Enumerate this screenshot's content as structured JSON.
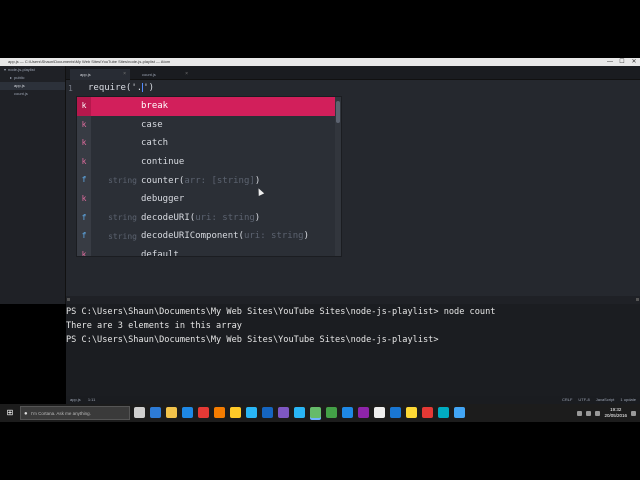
{
  "window": {
    "title": "app.js — C:\\Users\\Shaun\\Documents\\My Web Sites\\YouTube Sites\\node-js-playlist — Atom",
    "controls": {
      "minimize": "—",
      "maximize": "☐",
      "close": "✕"
    }
  },
  "tree_view": {
    "project": "node-js-playlist",
    "items": [
      {
        "label": "public",
        "icon": "folder-icon"
      },
      {
        "label": "app.js",
        "icon": "file-icon",
        "selected": true
      },
      {
        "label": "count.js",
        "icon": "file-icon"
      }
    ]
  },
  "tabs": [
    {
      "label": "app.js",
      "active": true
    },
    {
      "label": "count.js",
      "active": false
    }
  ],
  "editor": {
    "line_number": "1",
    "code_before_cursor": "require('.",
    "code_after_cursor": "')"
  },
  "autocomplete": {
    "items": [
      {
        "kind": "k",
        "type": "keyword",
        "left": "",
        "text": "break",
        "params": "",
        "tail": "",
        "selected": true
      },
      {
        "kind": "k",
        "type": "keyword",
        "left": "",
        "text": "case",
        "params": "",
        "tail": ""
      },
      {
        "kind": "k",
        "type": "keyword",
        "left": "",
        "text": "catch",
        "params": "",
        "tail": ""
      },
      {
        "kind": "k",
        "type": "keyword",
        "left": "",
        "text": "continue",
        "params": "",
        "tail": ""
      },
      {
        "kind": "f",
        "type": "function",
        "left": "string",
        "text": "counter(",
        "params": "arr: [string]",
        "tail": ")"
      },
      {
        "kind": "k",
        "type": "keyword",
        "left": "",
        "text": "debugger",
        "params": "",
        "tail": ""
      },
      {
        "kind": "f",
        "type": "function",
        "left": "string",
        "text": "decodeURI(",
        "params": "uri: string",
        "tail": ")"
      },
      {
        "kind": "f",
        "type": "function",
        "left": "string",
        "text": "decodeURIComponent(",
        "params": "uri: string",
        "tail": ")"
      },
      {
        "kind": "k",
        "type": "keyword",
        "left": "",
        "text": "default",
        "params": "",
        "tail": ""
      }
    ]
  },
  "terminal": {
    "lines": [
      "PS C:\\Users\\Shaun\\Documents\\My Web Sites\\YouTube Sites\\node-js-playlist> node count",
      "There are 3 elements in this array",
      "PS C:\\Users\\Shaun\\Documents\\My Web Sites\\YouTube Sites\\node-js-playlist>"
    ]
  },
  "status_bar": {
    "file": "app.js",
    "position": "1:11",
    "line_ending": "CRLF",
    "encoding": "UTF-8",
    "grammar": "JavaScript",
    "updates": "1 update"
  },
  "taskbar": {
    "start_icon": "windows-logo-icon",
    "search_placeholder": "I'm Cortana. Ask me anything.",
    "apps": [
      {
        "name": "task-view-icon",
        "color": "#cfcfcf"
      },
      {
        "name": "edge-icon",
        "color": "#2d7bd6"
      },
      {
        "name": "file-explorer-icon",
        "color": "#f2c34b"
      },
      {
        "name": "store-icon",
        "color": "#1e88e5"
      },
      {
        "name": "opera-icon",
        "color": "#e53935"
      },
      {
        "name": "firefox-icon",
        "color": "#f57c00"
      },
      {
        "name": "chrome-icon",
        "color": "#ffca28"
      },
      {
        "name": "ps-icon",
        "color": "#29b6f6"
      },
      {
        "name": "powershell-icon",
        "color": "#1565c0"
      },
      {
        "name": "visual-studio-icon",
        "color": "#7e57c2"
      },
      {
        "name": "skype-icon",
        "color": "#29b6f6"
      },
      {
        "name": "atom-icon",
        "color": "#66bb6a",
        "active": true
      },
      {
        "name": "green-app-icon",
        "color": "#43a047"
      },
      {
        "name": "blue-app-icon",
        "color": "#1e88e5"
      },
      {
        "name": "purple-app-icon",
        "color": "#8e24aa"
      },
      {
        "name": "obs-icon",
        "color": "#eeeeee"
      },
      {
        "name": "media-icon",
        "color": "#1976d2"
      },
      {
        "name": "yellow-app-icon",
        "color": "#fdd835"
      },
      {
        "name": "red-app-icon",
        "color": "#e53935"
      },
      {
        "name": "cyan-app-icon",
        "color": "#00acc1"
      },
      {
        "name": "snip-icon",
        "color": "#42a5f5"
      }
    ],
    "time": "19:32",
    "date": "20/05/2016"
  }
}
